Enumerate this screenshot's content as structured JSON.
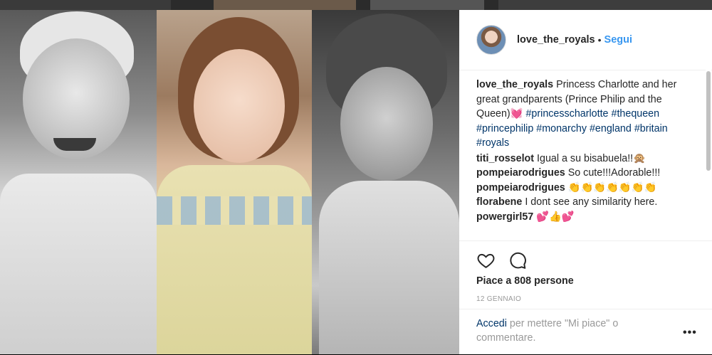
{
  "post": {
    "username": "love_the_royals",
    "separator": "•",
    "follow_label": "Segui"
  },
  "caption": {
    "username": "love_the_royals",
    "text": "Princess Charlotte and her great grandparents (Prince Philip and the Queen)💓",
    "hashtags": [
      "#princesscharlotte",
      "#thequeen",
      "#princephilip",
      "#monarchy",
      "#england",
      "#britain",
      "#royals"
    ]
  },
  "comments": [
    {
      "user": "titi_rosselot",
      "text": "Igual a su bisabuela!!🙊"
    },
    {
      "user": "pompeiarodrigues",
      "text": "So cute!!!Adorable!!!"
    },
    {
      "user": "pompeiarodrigues",
      "text": "👏👏👏👏👏👏👏"
    },
    {
      "user": "florabene",
      "text": "I dont see any similarity here."
    },
    {
      "user": "powergirl57",
      "text": "💕👍💕"
    }
  ],
  "likes_text": "Piace a 808 persone",
  "date": "12 GENNAIO",
  "login": {
    "link": "Accedi",
    "rest": "per mettere \"Mi piace\" o commentare."
  },
  "more_label": "•••",
  "icons": {
    "like": "heart-outline-icon",
    "comment": "speech-bubble-icon",
    "more": "more-options-icon"
  }
}
